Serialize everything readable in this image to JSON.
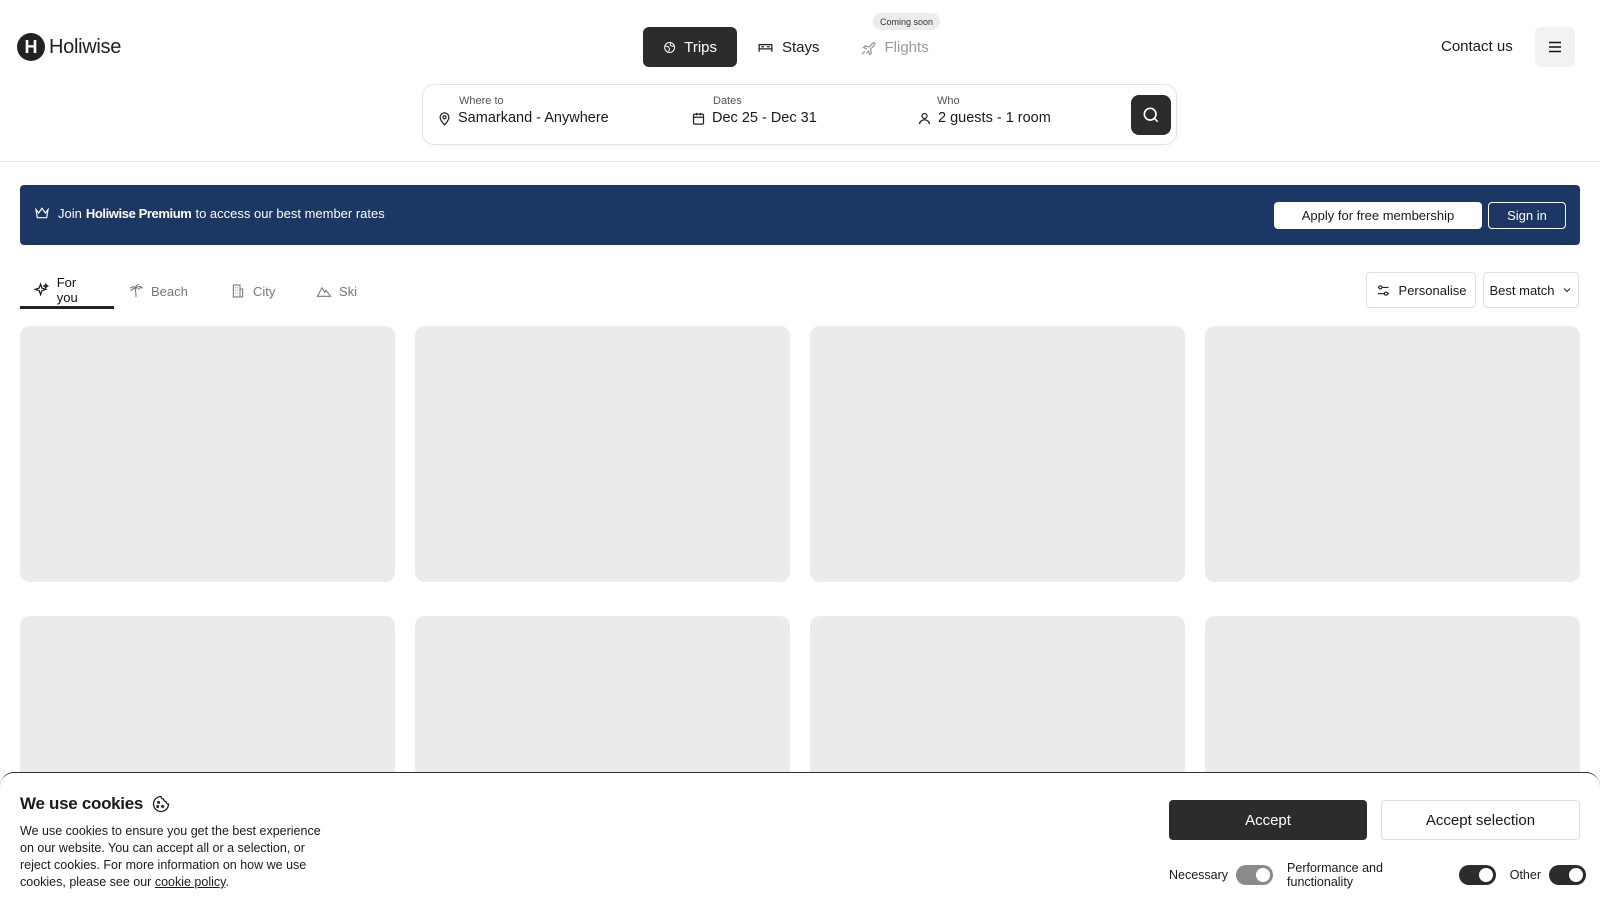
{
  "brand": {
    "logo_letter": "H",
    "name": "Holiwise"
  },
  "nav": {
    "tabs": [
      {
        "label": "Trips",
        "icon": "globe-icon",
        "active": true
      },
      {
        "label": "Stays",
        "icon": "bed-icon",
        "active": false
      },
      {
        "label": "Flights",
        "icon": "plane-icon",
        "active": false,
        "disabled": true
      }
    ],
    "coming_soon": "Coming soon",
    "contact": "Contact us",
    "menu_icon": "hamburger-icon"
  },
  "search": {
    "where_label": "Where to",
    "where_value": "Samarkand - Anywhere",
    "dates_label": "Dates",
    "dates_value": "Dec 25 - Dec 31",
    "who_label": "Who",
    "who_value": "2 guests - 1 room"
  },
  "banner": {
    "prefix": "Join",
    "brand": "Holiwise Premium",
    "suffix": "to access our best member rates",
    "apply": "Apply for free membership",
    "signin": "Sign in",
    "color": "#1c3764"
  },
  "filters": {
    "tabs": [
      {
        "label": "For you",
        "icon": "sparkle-icon",
        "active": true
      },
      {
        "label": "Beach",
        "icon": "palm-tree-icon",
        "active": false
      },
      {
        "label": "City",
        "icon": "building-icon",
        "active": false
      },
      {
        "label": "Ski",
        "icon": "mountain-icon",
        "active": false
      }
    ],
    "personalise": "Personalise",
    "sort": "Best match"
  },
  "cookies": {
    "title": "We use cookies",
    "text": "We use cookies to ensure you get the best experience on our website. You can accept all or a selection, or reject cookies. For more information on how we use cookies, please see our",
    "link": "cookie policy",
    "end": ".",
    "accept": "Accept",
    "accept_selection": "Accept selection",
    "toggles": [
      {
        "label": "Necessary",
        "on": true,
        "locked": true
      },
      {
        "label": "Performance and functionality",
        "on": true
      },
      {
        "label": "Other",
        "on": true
      }
    ]
  }
}
